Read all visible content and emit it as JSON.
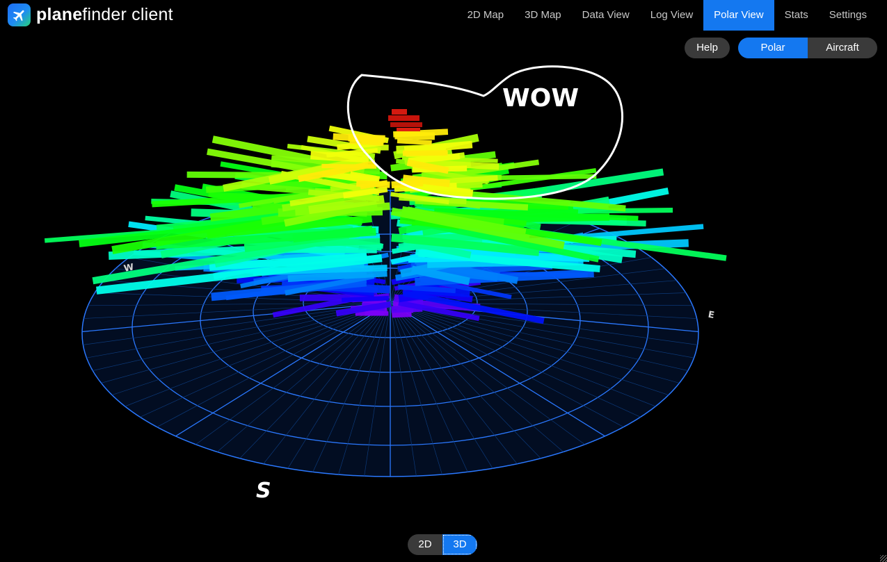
{
  "app": {
    "brand_bold": "plane",
    "brand_rest": "finder client",
    "icon": "airplane-icon"
  },
  "nav": [
    {
      "label": "2D Map",
      "active": false
    },
    {
      "label": "3D Map",
      "active": false
    },
    {
      "label": "Data View",
      "active": false
    },
    {
      "label": "Log View",
      "active": false
    },
    {
      "label": "Polar View",
      "active": true
    },
    {
      "label": "Stats",
      "active": false
    },
    {
      "label": "Settings",
      "active": false
    }
  ],
  "toolbar": {
    "help_label": "Help",
    "mode_polar": "Polar",
    "mode_aircraft": "Aircraft",
    "active_mode": "Polar"
  },
  "view_toggle": {
    "option_2d": "2D",
    "option_3d": "3D",
    "active": "3D"
  },
  "compass": {
    "west": "W",
    "east": "E",
    "south": "S"
  },
  "annotation": {
    "text": "WOW"
  },
  "colors": {
    "accent": "#1478f0",
    "grid": "#1e6fe0",
    "background": "#000000",
    "annotation": "#ffffff",
    "far_range": "#d41a10"
  }
}
